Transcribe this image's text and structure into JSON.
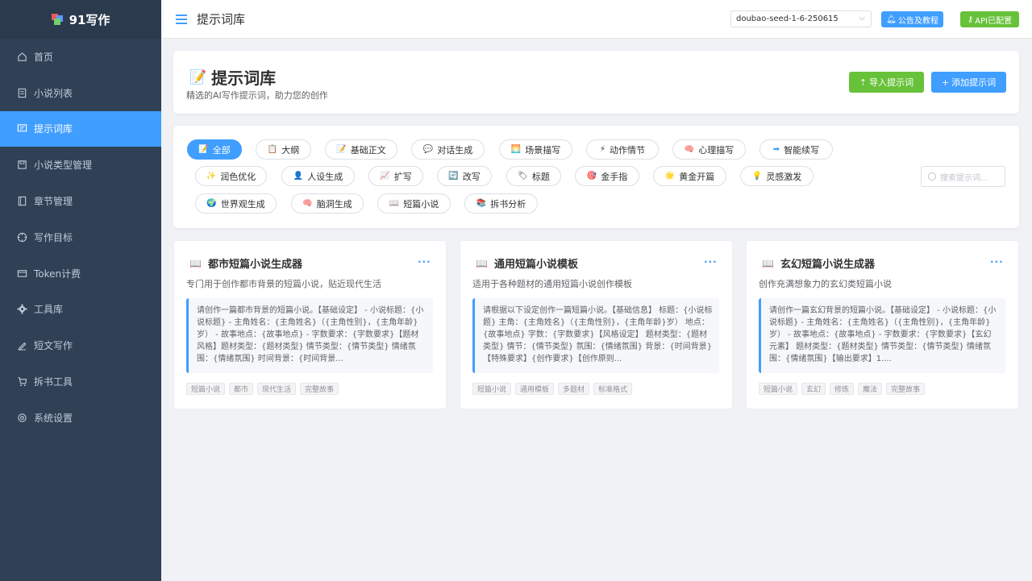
{
  "sidebar": {
    "logo": "91写作",
    "items": [
      {
        "label": "首页",
        "icon": "home-icon"
      },
      {
        "label": "小说列表",
        "icon": "document-icon"
      },
      {
        "label": "提示词库",
        "icon": "chat-icon"
      },
      {
        "label": "小说类型管理",
        "icon": "save-icon"
      },
      {
        "label": "章节管理",
        "icon": "book-icon"
      },
      {
        "label": "写作目标",
        "icon": "target-icon"
      },
      {
        "label": "Token计费",
        "icon": "card-icon"
      },
      {
        "label": "工具库",
        "icon": "gear-icon"
      },
      {
        "label": "短文写作",
        "icon": "pen-icon"
      },
      {
        "label": "拆书工具",
        "icon": "cart-icon"
      },
      {
        "label": "系统设置",
        "icon": "settings-icon"
      }
    ],
    "active_index": 2
  },
  "header": {
    "title": "提示词库",
    "model": "doubao-seed-1-6-250615",
    "notice_button": "公告及教程",
    "api_button": "API已配置"
  },
  "page": {
    "title": "提示词库",
    "subtitle": "精选的AI写作提示词，助力您的创作",
    "import_button": "导入提示词",
    "add_button": "添加提示词"
  },
  "filters": {
    "categories": [
      {
        "label": "全部",
        "icon": "📝"
      },
      {
        "label": "大纲",
        "icon": "📋"
      },
      {
        "label": "基础正文",
        "icon": "📝"
      },
      {
        "label": "对话生成",
        "icon": "💬"
      },
      {
        "label": "场景描写",
        "icon": "🌅"
      },
      {
        "label": "动作情节",
        "icon": "⚡"
      },
      {
        "label": "心理描写",
        "icon": "🧠"
      },
      {
        "label": "智能续写",
        "icon": "➡"
      },
      {
        "label": "润色优化",
        "icon": "✨"
      },
      {
        "label": "人设生成",
        "icon": "👤"
      },
      {
        "label": "扩写",
        "icon": "📈"
      },
      {
        "label": "改写",
        "icon": "🔄"
      },
      {
        "label": "标题",
        "icon": "🏷"
      },
      {
        "label": "金手指",
        "icon": "🎯"
      },
      {
        "label": "黄金开篇",
        "icon": "🌟"
      },
      {
        "label": "灵感激发",
        "icon": "💡"
      },
      {
        "label": "世界观生成",
        "icon": "🌍"
      },
      {
        "label": "脑洞生成",
        "icon": "🧠"
      },
      {
        "label": "短篇小说",
        "icon": "📖"
      },
      {
        "label": "拆书分析",
        "icon": "📚"
      }
    ],
    "active": "全部",
    "search_placeholder": "搜索提示词..."
  },
  "prompts": [
    {
      "title": "都市短篇小说生成器",
      "description": "专门用于创作都市背景的短篇小说，贴近现代生活",
      "body": "请创作一篇都市背景的短篇小说。【基础设定】 - 小说标题：{小说标题} - 主角姓名：{主角姓名}（{主角性别}，{主角年龄}岁） - 故事地点：{故事地点} - 字数要求：{字数要求}【题材风格】题材类型：{题材类型} 情节类型：{情节类型} 情绪氛围：{情绪氛围} 时间背景：{时间背景...",
      "tags": [
        "短篇小说",
        "都市",
        "现代生活",
        "完整故事"
      ]
    },
    {
      "title": "通用短篇小说模板",
      "description": "适用于各种题材的通用短篇小说创作模板",
      "body": "请根据以下设定创作一篇短篇小说。【基础信息】 标题：{小说标题} 主角：{主角姓名}（{主角性别}，{主角年龄}岁） 地点：{故事地点} 字数：{字数要求}【风格设定】 题材类型：{题材类型} 情节：{情节类型} 氛围：{情绪氛围} 背景：{时间背景}【特殊要求】{创作要求}【创作原则...",
      "tags": [
        "短篇小说",
        "通用模板",
        "多题材",
        "标准格式"
      ]
    },
    {
      "title": "玄幻短篇小说生成器",
      "description": "创作充满想象力的玄幻类短篇小说",
      "body": "请创作一篇玄幻背景的短篇小说。【基础设定】 - 小说标题：{小说标题} - 主角姓名：{主角姓名}（{主角性别}，{主角年龄}岁） - 故事地点：{故事地点} - 字数要求：{字数要求}【玄幻元素】 题材类型：{题材类型} 情节类型：{情节类型} 情绪氛围：{情绪氛围}【输出要求】1....",
      "tags": [
        "短篇小说",
        "玄幻",
        "修炼",
        "魔法",
        "完整故事"
      ]
    }
  ],
  "colors": {
    "primary": "#409eff",
    "success": "#67c23a",
    "sidebar_bg": "#304156"
  }
}
